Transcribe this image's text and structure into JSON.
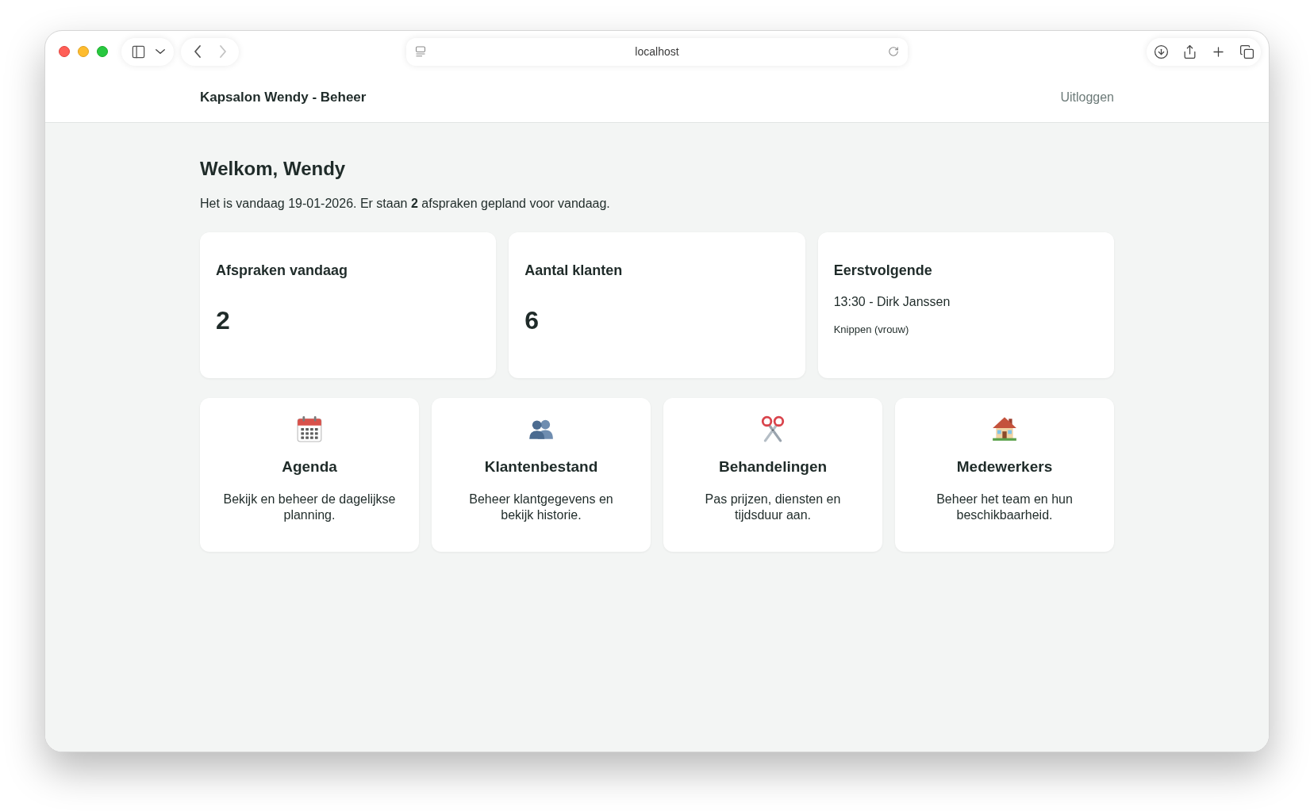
{
  "browser": {
    "nav_buttons": [
      {
        "kind": "back",
        "disabled": false
      },
      {
        "kind": "forward",
        "disabled": true
      }
    ],
    "address": "localhost"
  },
  "header": {
    "title": "Kapsalon Wendy - Beheer",
    "logout": "Uitloggen"
  },
  "welcome": {
    "heading": "Welkom, Wendy",
    "summary": "Het is vandaag 19-01-2026. Er staan **2** afspraken gepland voor vandaag."
  },
  "stats": [
    {
      "kind": "count",
      "title": "Afspraken vandaag",
      "value": "2"
    },
    {
      "kind": "count",
      "title": "Aantal klanten",
      "value": "6"
    },
    {
      "kind": "next",
      "title": "Eerstvolgende",
      "line": "13:30 - Dirk Janssen",
      "detail": "Knippen (vrouw)"
    }
  ],
  "nav_cards": [
    {
      "kind": "calendar",
      "title": "Agenda",
      "description": "Bekijk en beheer de dagelijkse planning."
    },
    {
      "kind": "people",
      "title": "Klantenbestand",
      "description": "Beheer klantgegevens en bekijk historie."
    },
    {
      "kind": "scissors",
      "title": "Behandelingen",
      "description": "Pas prijzen, diensten en tijdsduur aan."
    },
    {
      "kind": "house",
      "title": "Medewerkers",
      "description": "Beheer het team en hun beschikbaarheid."
    }
  ]
}
